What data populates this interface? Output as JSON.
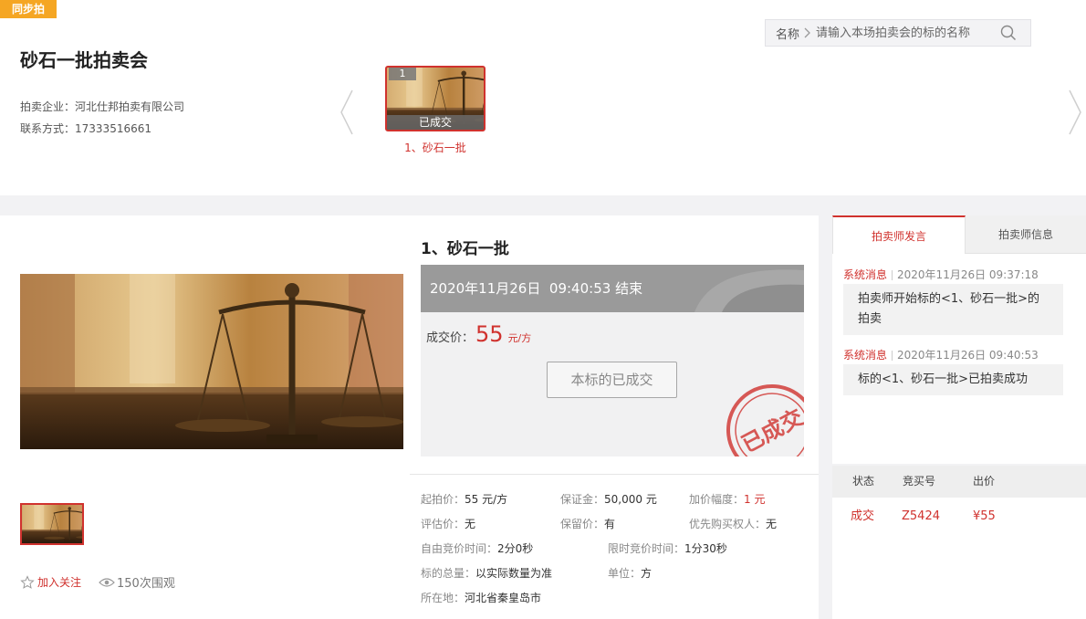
{
  "header": {
    "badge": "同步拍",
    "auction_title": "砂石一批拍卖会",
    "company_label": "拍卖企业：",
    "company_name": "河北仕邦拍卖有限公司",
    "contact_label": "联系方式：",
    "contact_phone": "17333516661"
  },
  "search": {
    "label": "名称",
    "placeholder": "请输入本场拍卖会的标的名称"
  },
  "lot_carousel": {
    "items": [
      {
        "number": "1",
        "status": "已成交",
        "caption": "1、砂石一批"
      }
    ]
  },
  "lot": {
    "title": "1、砂石一批",
    "end_date": "2020年11月26日",
    "end_time": "09:40:53",
    "end_suffix": "结束",
    "deal_label": "成交价：",
    "deal_price": "55",
    "deal_unit": "元/方",
    "done_button": "本标的已成交",
    "stamp_text": "已成交",
    "follow_label": "加入关注",
    "views": "150次围观"
  },
  "details": {
    "start_price_label": "起拍价：",
    "start_price": "55 元/方",
    "deposit_label": "保证金：",
    "deposit": "50,000 元",
    "increment_label": "加价幅度：",
    "increment": "1 元",
    "appraisal_label": "评估价：",
    "appraisal": "无",
    "reserve_label": "保留价：",
    "reserve": "有",
    "priority_label": "优先购买权人：",
    "priority": "无",
    "free_time_label": "自由竞价时间：",
    "free_time": "2分0秒",
    "limit_time_label": "限时竞价时间：",
    "limit_time": "1分30秒",
    "quantity_label": "标的总量：",
    "quantity": "以实际数量为准",
    "unit_label": "单位：",
    "unit": "方",
    "location_label": "所在地：",
    "location": "河北省秦皇岛市"
  },
  "sidebar": {
    "tab_speech": "拍卖师发言",
    "tab_info": "拍卖师信息",
    "messages": [
      {
        "source": "系统消息",
        "time": "2020年11月26日   09:37:18",
        "text": "拍卖师开始标的<1、砂石一批>的拍卖"
      },
      {
        "source": "系统消息",
        "time": "2020年11月26日   09:40:53",
        "text": "标的<1、砂石一批>已拍卖成功"
      }
    ]
  },
  "bids": {
    "columns": [
      "状态",
      "竞买号",
      "出价"
    ],
    "rows": [
      {
        "status": "成交",
        "bidder": "Z5424",
        "price": "¥55"
      }
    ]
  },
  "colors": {
    "accent": "#d0322e",
    "badge": "#f5a623"
  }
}
